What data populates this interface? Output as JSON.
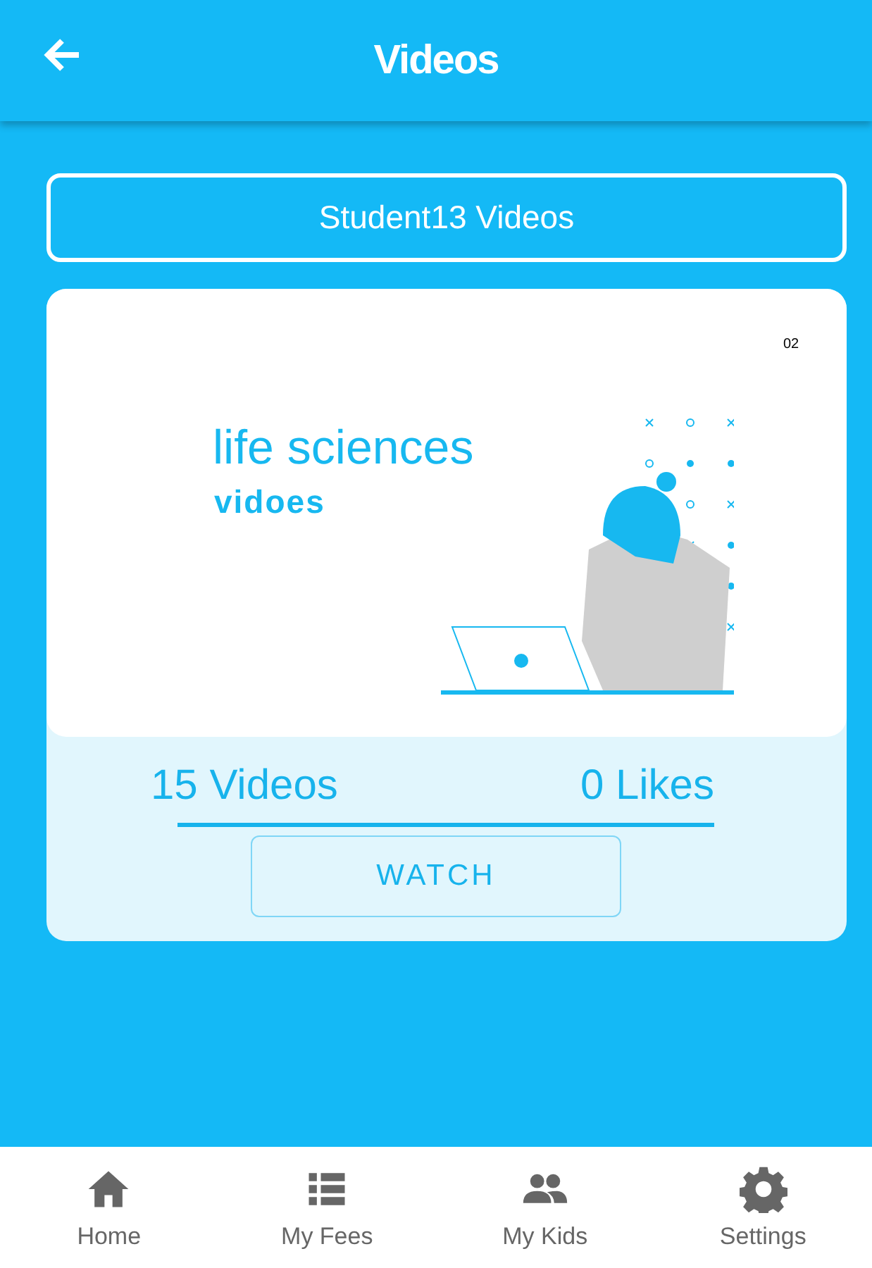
{
  "header": {
    "title": "Videos"
  },
  "section_button": "Student13 Videos",
  "video_card": {
    "thumbnail": {
      "kind": "picture",
      "title": "life sciences",
      "subtitle": "vidoes",
      "slide_number": "02"
    },
    "videos_count": "15 Videos",
    "likes": "0 Likes",
    "action": "WATCH"
  },
  "bottom_nav": [
    {
      "label": "Home",
      "selected": false
    },
    {
      "label": "My Fees",
      "selected": false
    },
    {
      "label": "My Kids",
      "selected": false
    },
    {
      "label": "Settings",
      "selected": false
    }
  ]
}
